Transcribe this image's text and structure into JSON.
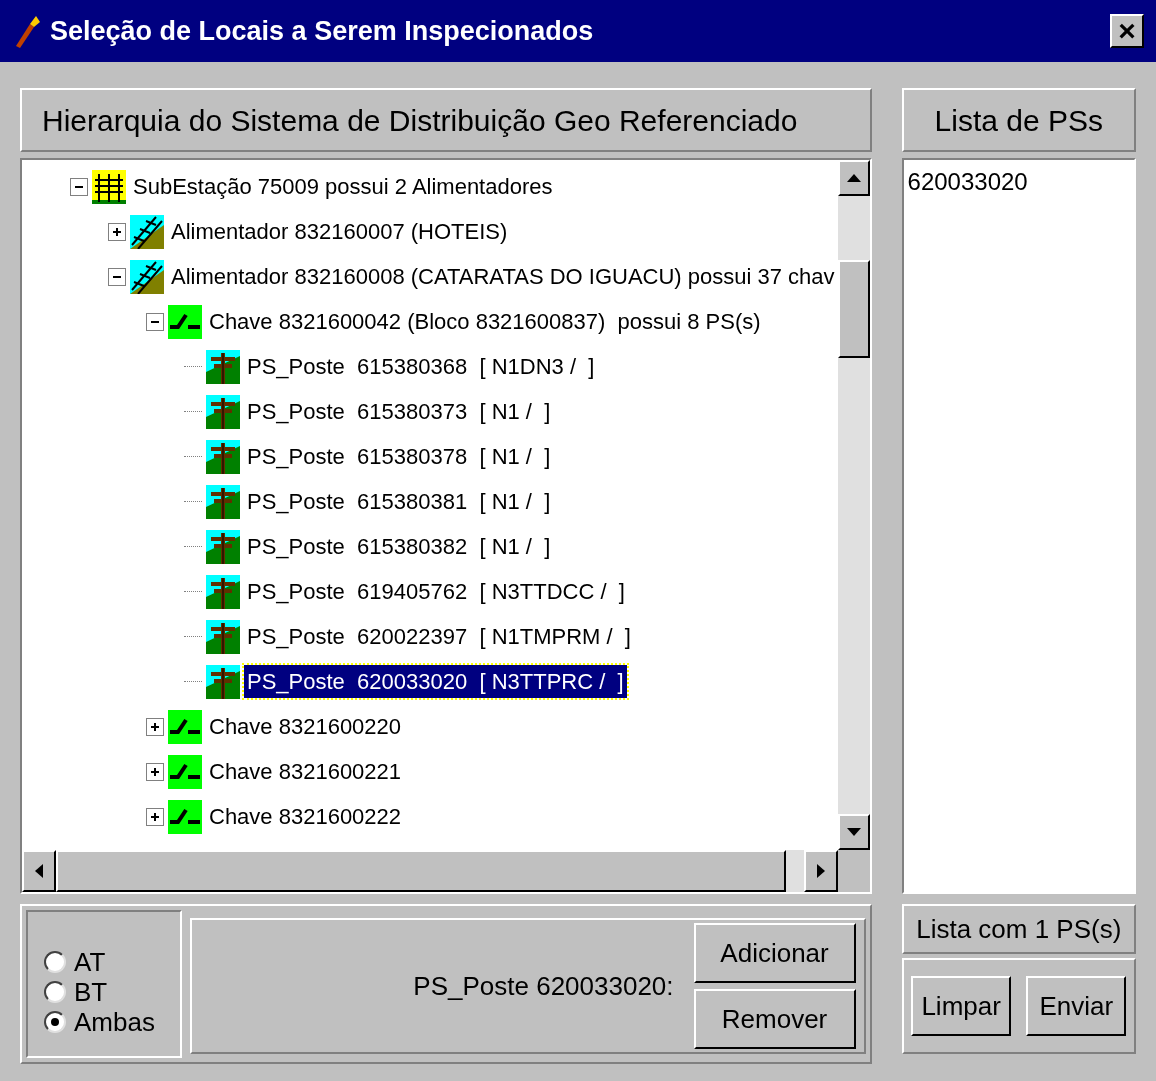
{
  "window": {
    "title": "Seleção de Locais a Serem Inspecionados",
    "close": "×"
  },
  "hierarchy": {
    "header": "Hierarquia do Sistema de Distribuição Geo Referenciado",
    "tree": [
      {
        "kind": "substation",
        "label": "SubEstação 75009 possui 2 Alimentadores",
        "expanded": true,
        "selected": false,
        "children": [
          {
            "kind": "feeder",
            "label": "Alimentador 832160007 (HOTEIS)",
            "expanded": false,
            "selected": false
          },
          {
            "kind": "feeder",
            "label": "Alimentador 832160008 (CATARATAS DO IGUACU) possui 37 chav",
            "expanded": true,
            "selected": false,
            "children": [
              {
                "kind": "switch",
                "label": "Chave 8321600042 (Bloco 8321600837)  possui 8 PS(s)",
                "expanded": true,
                "selected": false,
                "children": [
                  {
                    "kind": "pole",
                    "label": "PS_Poste  615380368  [ N1DN3 /  ]",
                    "selected": false
                  },
                  {
                    "kind": "pole",
                    "label": "PS_Poste  615380373  [ N1 /  ]",
                    "selected": false
                  },
                  {
                    "kind": "pole",
                    "label": "PS_Poste  615380378  [ N1 /  ]",
                    "selected": false
                  },
                  {
                    "kind": "pole",
                    "label": "PS_Poste  615380381  [ N1 /  ]",
                    "selected": false
                  },
                  {
                    "kind": "pole",
                    "label": "PS_Poste  615380382  [ N1 /  ]",
                    "selected": false
                  },
                  {
                    "kind": "pole",
                    "label": "PS_Poste  619405762  [ N3TTDCC /  ]",
                    "selected": false
                  },
                  {
                    "kind": "pole",
                    "label": "PS_Poste  620022397  [ N1TMPRM /  ]",
                    "selected": false
                  },
                  {
                    "kind": "pole",
                    "label": "PS_Poste  620033020  [ N3TTPRC /  ]",
                    "selected": true
                  }
                ]
              },
              {
                "kind": "switch",
                "label": "Chave 8321600220",
                "expanded": false,
                "selected": false
              },
              {
                "kind": "switch",
                "label": "Chave 8321600221",
                "expanded": false,
                "selected": false
              },
              {
                "kind": "switch",
                "label": "Chave 8321600222",
                "expanded": false,
                "selected": false
              }
            ]
          }
        ]
      }
    ]
  },
  "voltage": [
    {
      "label": "AT",
      "selected": false
    },
    {
      "label": "BT",
      "selected": false
    },
    {
      "label": "Ambas",
      "selected": true
    }
  ],
  "selection_label": "PS_Poste 620033020:",
  "actions": [
    "Adicionar",
    "Remover"
  ],
  "ps_list": {
    "header": "Lista de PSs",
    "items": [
      "620033020"
    ],
    "count": "Lista com 1 PS(s)",
    "buttons": [
      "Limpar",
      "Enviar"
    ]
  }
}
